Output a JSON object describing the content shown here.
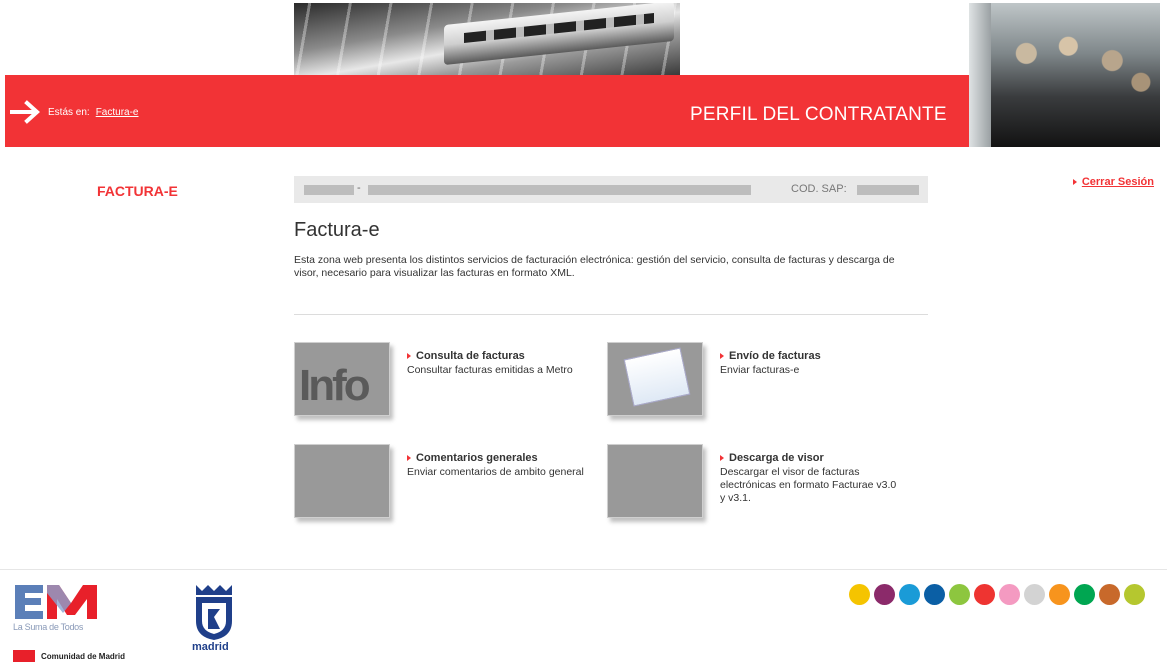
{
  "header": {
    "breadcrumb_prefix": "Estás en:",
    "breadcrumb_link": "Factura-e",
    "title": "PERFIL DEL CONTRATANTE"
  },
  "sidebar": {
    "section_title": "FACTURA-E"
  },
  "user": {
    "logout_label": "Cerrar Sesión",
    "sap_label": "COD. SAP:",
    "separator": "-"
  },
  "main": {
    "title": "Factura-e",
    "intro": "Esta zona web presenta los distintos servicios de facturación electrónica: gestión del servicio, consulta de facturas y descarga de visor, necesario para visualizar las facturas en formato XML.",
    "services": [
      {
        "title": "Consulta de facturas",
        "desc": "Consultar facturas emitidas a Metro",
        "thumb_text": "Info"
      },
      {
        "title": "Envío de facturas",
        "desc": "Enviar facturas-e"
      },
      {
        "title": "Comentarios generales",
        "desc": "Enviar comentarios de ambito general"
      },
      {
        "title": "Descarga de visor",
        "desc": "Descargar el visor de facturas electrónicas en formato Facturae v3.0 y v3.1."
      }
    ]
  },
  "footer": {
    "metro_tagline": "La Suma de Todos",
    "cm_label": "Comunidad de Madrid",
    "madrid_label": "madrid",
    "dot_colors": [
      "#f5c400",
      "#8b2a6a",
      "#1a9bd7",
      "#0b5fa5",
      "#8dc63f",
      "#ee3431",
      "#f49ac1",
      "#d3d3d3",
      "#f7941d",
      "#00a651",
      "#c8692b",
      "#b5c72f"
    ]
  },
  "colors": {
    "accent": "#f23336"
  }
}
